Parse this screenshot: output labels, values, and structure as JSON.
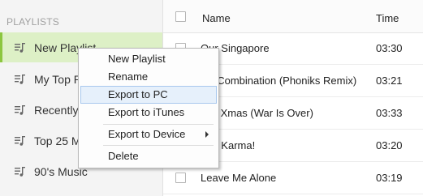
{
  "sidebar": {
    "header": "PLAYLISTS",
    "items": [
      {
        "label": "New Playlist"
      },
      {
        "label": "My Top R"
      },
      {
        "label": "Recently"
      },
      {
        "label": "Top 25 M"
      },
      {
        "label": "90's Music"
      }
    ],
    "selected_index": 0,
    "accent": "#8cc63f"
  },
  "table": {
    "columns": {
      "name": "Name",
      "time": "Time"
    },
    "rows": [
      {
        "name": "Our Singapore",
        "time": "03:30"
      },
      {
        "name": "dly Combination (Phoniks Remix)",
        "time": "03:21"
      },
      {
        "name": "ppy Xmas (War Is Over)",
        "time": "03:33"
      },
      {
        "name": "tant Karma!",
        "time": "03:20"
      },
      {
        "name": "Leave Me Alone",
        "time": "03:19"
      }
    ]
  },
  "context_menu": {
    "items": [
      {
        "label": "New Playlist"
      },
      {
        "label": "Rename"
      },
      {
        "label": "Export to PC"
      },
      {
        "label": "Export to iTunes"
      },
      {
        "label": "Export to Device"
      },
      {
        "label": "Delete"
      }
    ],
    "highlighted": "Export to PC",
    "highlight_color": "#e6f0fb"
  }
}
